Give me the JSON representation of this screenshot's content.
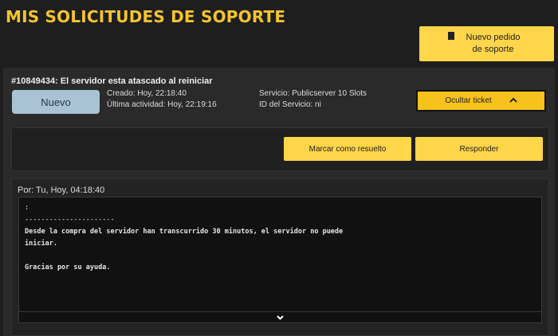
{
  "page": {
    "title": "MIS SOLICITUDES DE SOPORTE",
    "new_request_label": "Nuevo pedido de soporte",
    "new_request_icon": "document-icon"
  },
  "ticket": {
    "heading": "#10849434: El servidor esta atascado al reiniciar",
    "status": "Nuevo",
    "created": "Creado: Hoy, 22:18:40",
    "last_activity": "Última actividad: Hoy, 22:19:16",
    "service": "Servicio: Publicserver 10 Slots",
    "service_id": "ID del Servicio: ni",
    "hide_label": "Ocultar ticket",
    "hide_icon": "chevron-up-icon",
    "status_color": "#a9c2d4",
    "accent_color": "#ffd54a"
  },
  "actions": {
    "resolve_label": "Marcar como resuelto",
    "reply_label": "Responder"
  },
  "message": {
    "author": "Por: Tu, Hoy, 04:18:40",
    "lines": [
      ":",
      "----------------------",
      "Desde la compra del servidor han transcurrido 30 minutos, el servidor no puede",
      "iniciar.",
      "",
      "Gracias por su ayuda."
    ],
    "expand_icon": "chevron-down-icon"
  }
}
